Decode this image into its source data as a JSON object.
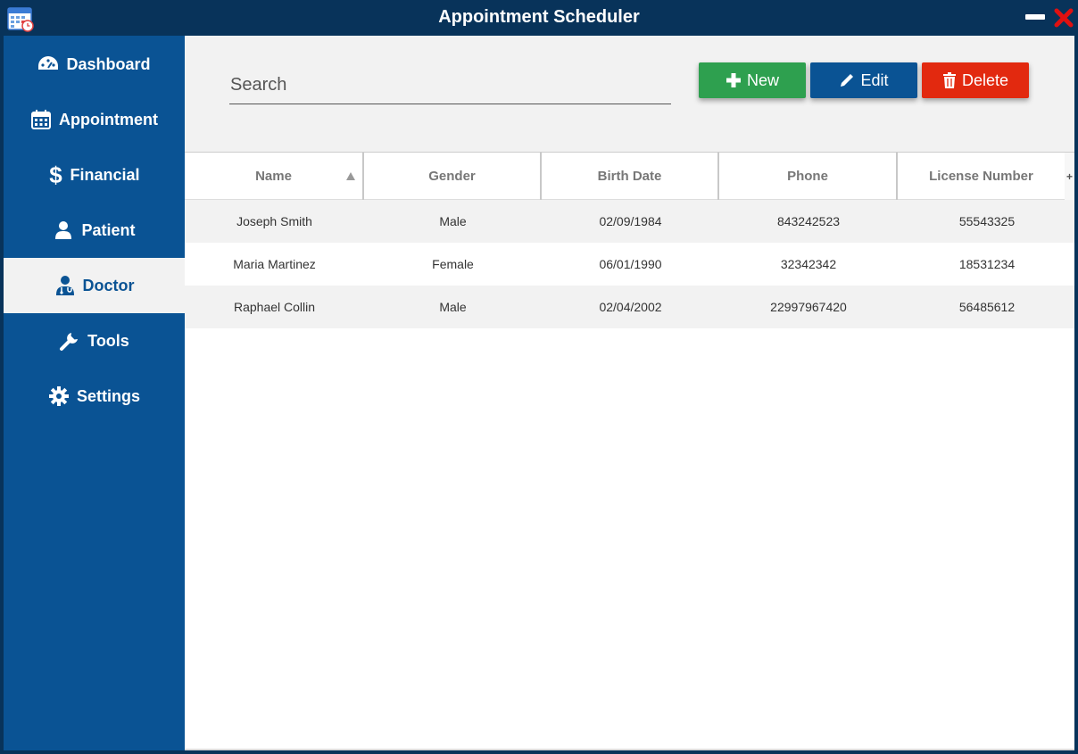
{
  "window": {
    "title": "Appointment Scheduler",
    "colors": {
      "titlebar": "#08335a",
      "sidebar": "#0a5394",
      "close": "#e01010"
    }
  },
  "sidebar": {
    "items": [
      {
        "label": "Dashboard",
        "icon": "dashboard-icon"
      },
      {
        "label": "Appointment",
        "icon": "calendar-icon"
      },
      {
        "label": "Financial",
        "icon": "dollar-icon"
      },
      {
        "label": "Patient",
        "icon": "user-icon"
      },
      {
        "label": "Doctor",
        "icon": "doctor-icon",
        "active": true
      },
      {
        "label": "Tools",
        "icon": "wrench-icon"
      },
      {
        "label": "Settings",
        "icon": "gear-icon"
      }
    ]
  },
  "toolbar": {
    "search_placeholder": "Search",
    "new_label": "New",
    "edit_label": "Edit",
    "delete_label": "Delete",
    "colors": {
      "new": "#2ea04f",
      "edit": "#0a5394",
      "delete": "#e2290f"
    }
  },
  "table": {
    "columns": [
      "Name",
      "Gender",
      "Birth Date",
      "Phone",
      "License Number"
    ],
    "sort": {
      "column": "Name",
      "direction": "ascending"
    },
    "add_column_label": "+",
    "rows": [
      [
        "Joseph Smith",
        "Male",
        "02/09/1984",
        "843242523",
        "55543325"
      ],
      [
        "Maria Martinez",
        "Female",
        "06/01/1990",
        "32342342",
        "18531234"
      ],
      [
        "Raphael Collin",
        "Male",
        "02/04/2002",
        "22997967420",
        "56485612"
      ]
    ]
  }
}
